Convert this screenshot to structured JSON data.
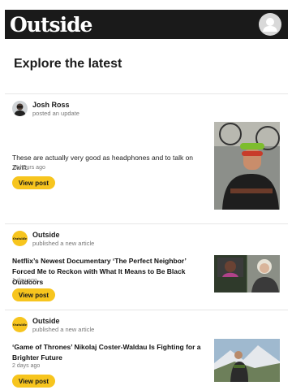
{
  "header": {
    "logo_text": "Outside",
    "profile_icon": "user-avatar-icon"
  },
  "page_title": "Explore the latest",
  "colors": {
    "header_bg": "#1a1a1a",
    "button_accent": "#f7c51e",
    "outside_badge": "#f7c51e"
  },
  "feed": [
    {
      "author": "Josh Ross",
      "action": "posted an update",
      "text": "These are actually very good as headphones and to talk on Zwift.",
      "time": "15 hours ago",
      "button": "View post"
    },
    {
      "author": "Outside",
      "avatar_text": "Outside",
      "action": "published a new article",
      "text": "Netflix’s Newest Documentary ‘The Perfect Neighbor’ Forced Me to Reckon with What It Means to Be Black Outdoors",
      "time": "1 day ago",
      "button": "View post"
    },
    {
      "author": "Outside",
      "avatar_text": "Outside",
      "action": "published a new article",
      "text": "‘Game of Thrones’ Nikolaj Coster-Waldau Is Fighting for a Brighter Future",
      "time": "2 days ago",
      "button": "View post"
    }
  ]
}
